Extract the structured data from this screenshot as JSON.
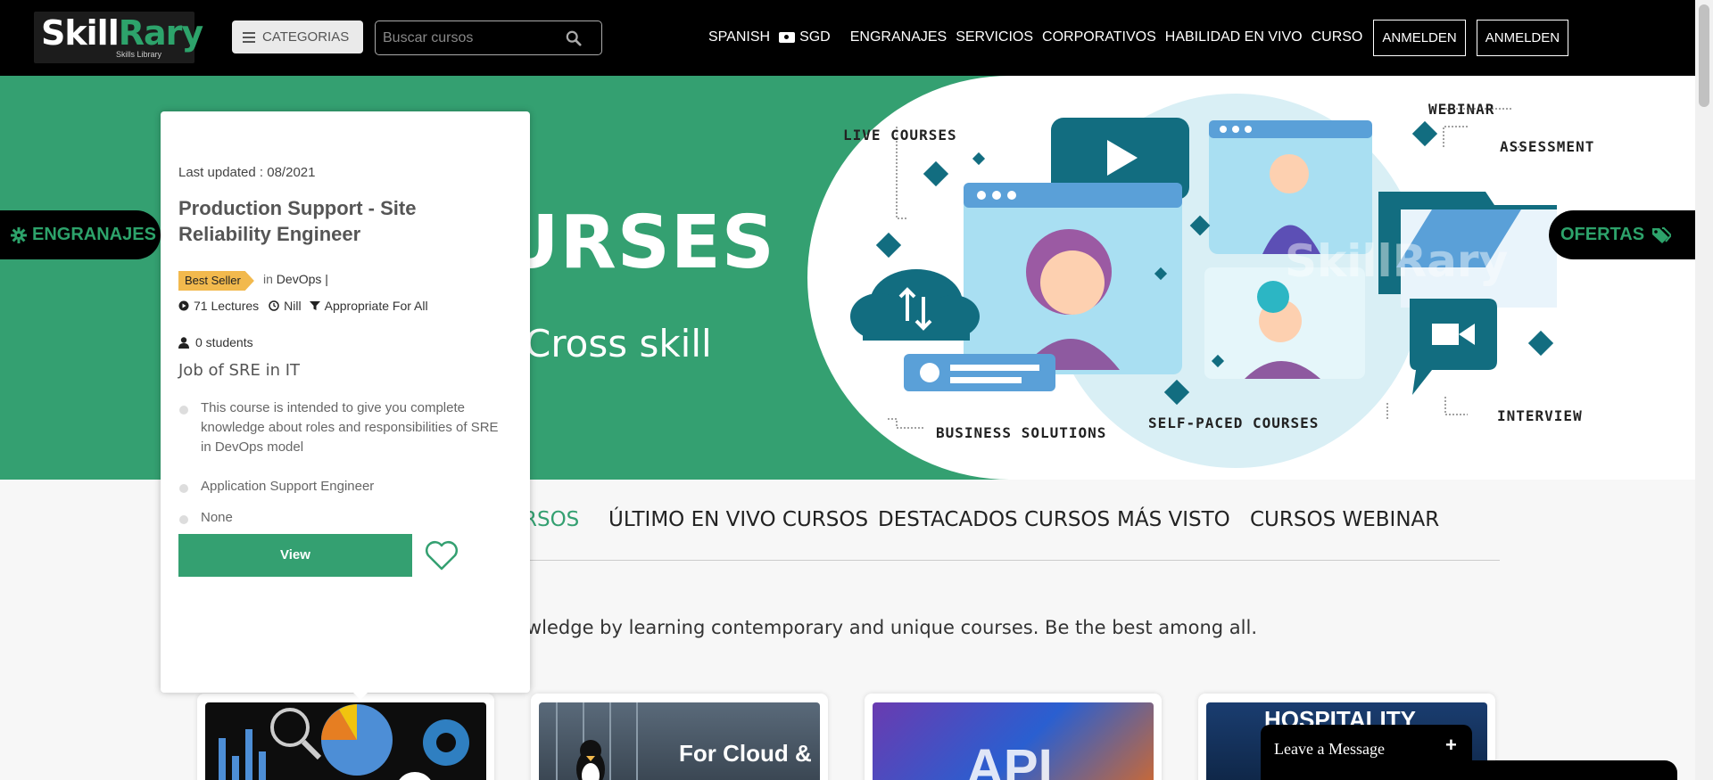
{
  "header": {
    "logo_text_a": "Skill",
    "logo_text_b": "Rary",
    "logo_sub": "Skills Library",
    "categories_label": "CATEGORIAS",
    "search_placeholder": "Buscar cursos",
    "nav": {
      "language": "SPANISH",
      "currency": "SGD",
      "items": [
        "ENGRANAJES",
        "SERVICIOS",
        "CORPORATIVOS",
        "HABILIDAD EN VIVO",
        "CURSO"
      ],
      "login_1": "ANMELDEN",
      "login_2": "ANMELDEN"
    }
  },
  "banner": {
    "title": "URSES",
    "subtitle": "Cross skill",
    "labels": {
      "live": "LIVE COURSES",
      "webinar": "WEBINAR",
      "assessment": "ASSESSMENT",
      "business": "BUSINESS SOLUTIONS",
      "selfpaced": "SELF-PACED COURSES",
      "interview": "INTERVIEW"
    },
    "watermark": "SkillRary",
    "left_tab": "ENGRANAJES",
    "right_tab": "OFERTAS"
  },
  "tabs": [
    "RSOS",
    "ÚLTIMO EN VIVO CURSOS",
    "DESTACADOS CURSOS",
    "MÁS VISTO",
    "CURSOS WEBINAR"
  ],
  "tagline": "wledge by learning contemporary and unique courses. Be the best among all.",
  "cards": [
    {
      "text": ""
    },
    {
      "text": "For Cloud &"
    },
    {
      "text": "API"
    },
    {
      "text": "HOSPITALITY"
    }
  ],
  "popup": {
    "updated": "Last updated : 08/2021",
    "title": "Production Support - Site Reliability Engineer",
    "badge": "Best Seller",
    "in_prefix": "in",
    "category": "DevOps",
    "category_sep": "|",
    "lectures": "71 Lectures",
    "duration": "Nill",
    "level": "Appropriate For All",
    "students": "0 students",
    "subtitle": "Job of SRE in IT",
    "points": [
      "This course is intended to give you complete knowledge about roles and responsibilities of SRE in DevOps model",
      "Application Support Engineer",
      "None"
    ],
    "view_label": "View"
  },
  "chat": {
    "label": "Leave a Message",
    "plus": "+"
  },
  "colors": {
    "brand_green": "#34a071",
    "header_bg": "#000000",
    "badge": "#f2b94d"
  }
}
